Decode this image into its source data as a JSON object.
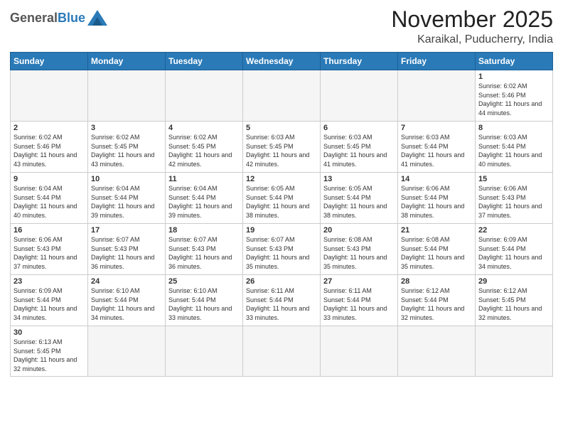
{
  "logo": {
    "general": "General",
    "blue": "Blue"
  },
  "title": "November 2025",
  "subtitle": "Karaikal, Puducherry, India",
  "days_header": [
    "Sunday",
    "Monday",
    "Tuesday",
    "Wednesday",
    "Thursday",
    "Friday",
    "Saturday"
  ],
  "weeks": [
    [
      {
        "day": "",
        "info": ""
      },
      {
        "day": "",
        "info": ""
      },
      {
        "day": "",
        "info": ""
      },
      {
        "day": "",
        "info": ""
      },
      {
        "day": "",
        "info": ""
      },
      {
        "day": "",
        "info": ""
      },
      {
        "day": "1",
        "info": "Sunrise: 6:02 AM\nSunset: 5:46 PM\nDaylight: 11 hours\nand 44 minutes."
      }
    ],
    [
      {
        "day": "2",
        "info": "Sunrise: 6:02 AM\nSunset: 5:46 PM\nDaylight: 11 hours\nand 43 minutes."
      },
      {
        "day": "3",
        "info": "Sunrise: 6:02 AM\nSunset: 5:45 PM\nDaylight: 11 hours\nand 43 minutes."
      },
      {
        "day": "4",
        "info": "Sunrise: 6:02 AM\nSunset: 5:45 PM\nDaylight: 11 hours\nand 42 minutes."
      },
      {
        "day": "5",
        "info": "Sunrise: 6:03 AM\nSunset: 5:45 PM\nDaylight: 11 hours\nand 42 minutes."
      },
      {
        "day": "6",
        "info": "Sunrise: 6:03 AM\nSunset: 5:45 PM\nDaylight: 11 hours\nand 41 minutes."
      },
      {
        "day": "7",
        "info": "Sunrise: 6:03 AM\nSunset: 5:44 PM\nDaylight: 11 hours\nand 41 minutes."
      },
      {
        "day": "8",
        "info": "Sunrise: 6:03 AM\nSunset: 5:44 PM\nDaylight: 11 hours\nand 40 minutes."
      }
    ],
    [
      {
        "day": "9",
        "info": "Sunrise: 6:04 AM\nSunset: 5:44 PM\nDaylight: 11 hours\nand 40 minutes."
      },
      {
        "day": "10",
        "info": "Sunrise: 6:04 AM\nSunset: 5:44 PM\nDaylight: 11 hours\nand 39 minutes."
      },
      {
        "day": "11",
        "info": "Sunrise: 6:04 AM\nSunset: 5:44 PM\nDaylight: 11 hours\nand 39 minutes."
      },
      {
        "day": "12",
        "info": "Sunrise: 6:05 AM\nSunset: 5:44 PM\nDaylight: 11 hours\nand 38 minutes."
      },
      {
        "day": "13",
        "info": "Sunrise: 6:05 AM\nSunset: 5:44 PM\nDaylight: 11 hours\nand 38 minutes."
      },
      {
        "day": "14",
        "info": "Sunrise: 6:06 AM\nSunset: 5:44 PM\nDaylight: 11 hours\nand 38 minutes."
      },
      {
        "day": "15",
        "info": "Sunrise: 6:06 AM\nSunset: 5:43 PM\nDaylight: 11 hours\nand 37 minutes."
      }
    ],
    [
      {
        "day": "16",
        "info": "Sunrise: 6:06 AM\nSunset: 5:43 PM\nDaylight: 11 hours\nand 37 minutes."
      },
      {
        "day": "17",
        "info": "Sunrise: 6:07 AM\nSunset: 5:43 PM\nDaylight: 11 hours\nand 36 minutes."
      },
      {
        "day": "18",
        "info": "Sunrise: 6:07 AM\nSunset: 5:43 PM\nDaylight: 11 hours\nand 36 minutes."
      },
      {
        "day": "19",
        "info": "Sunrise: 6:07 AM\nSunset: 5:43 PM\nDaylight: 11 hours\nand 35 minutes."
      },
      {
        "day": "20",
        "info": "Sunrise: 6:08 AM\nSunset: 5:43 PM\nDaylight: 11 hours\nand 35 minutes."
      },
      {
        "day": "21",
        "info": "Sunrise: 6:08 AM\nSunset: 5:44 PM\nDaylight: 11 hours\nand 35 minutes."
      },
      {
        "day": "22",
        "info": "Sunrise: 6:09 AM\nSunset: 5:44 PM\nDaylight: 11 hours\nand 34 minutes."
      }
    ],
    [
      {
        "day": "23",
        "info": "Sunrise: 6:09 AM\nSunset: 5:44 PM\nDaylight: 11 hours\nand 34 minutes."
      },
      {
        "day": "24",
        "info": "Sunrise: 6:10 AM\nSunset: 5:44 PM\nDaylight: 11 hours\nand 34 minutes."
      },
      {
        "day": "25",
        "info": "Sunrise: 6:10 AM\nSunset: 5:44 PM\nDaylight: 11 hours\nand 33 minutes."
      },
      {
        "day": "26",
        "info": "Sunrise: 6:11 AM\nSunset: 5:44 PM\nDaylight: 11 hours\nand 33 minutes."
      },
      {
        "day": "27",
        "info": "Sunrise: 6:11 AM\nSunset: 5:44 PM\nDaylight: 11 hours\nand 33 minutes."
      },
      {
        "day": "28",
        "info": "Sunrise: 6:12 AM\nSunset: 5:44 PM\nDaylight: 11 hours\nand 32 minutes."
      },
      {
        "day": "29",
        "info": "Sunrise: 6:12 AM\nSunset: 5:45 PM\nDaylight: 11 hours\nand 32 minutes."
      }
    ],
    [
      {
        "day": "30",
        "info": "Sunrise: 6:13 AM\nSunset: 5:45 PM\nDaylight: 11 hours\nand 32 minutes."
      },
      {
        "day": "",
        "info": ""
      },
      {
        "day": "",
        "info": ""
      },
      {
        "day": "",
        "info": ""
      },
      {
        "day": "",
        "info": ""
      },
      {
        "day": "",
        "info": ""
      },
      {
        "day": "",
        "info": ""
      }
    ]
  ]
}
